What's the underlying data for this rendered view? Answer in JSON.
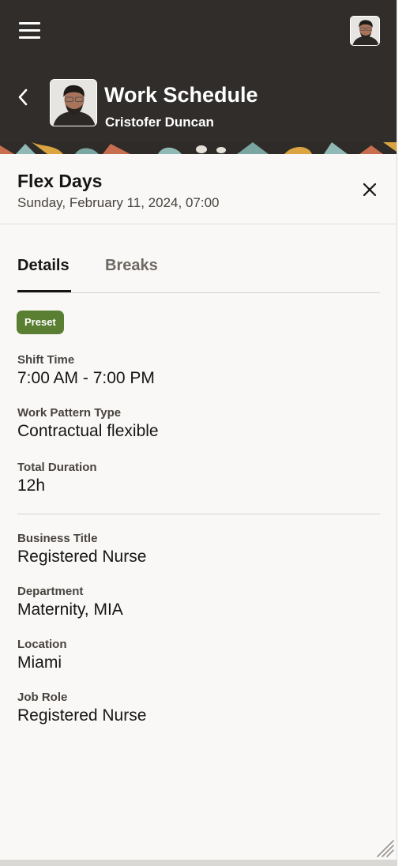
{
  "header": {
    "title": "Work Schedule",
    "subtitle": "Cristofer Duncan",
    "menu_icon": "hamburger-icon",
    "back_icon": "chevron-left-icon",
    "background_color": "#312d2a"
  },
  "drawer": {
    "title": "Flex Days",
    "date": "Sunday, February 11, 2024, 07:00",
    "close_icon": "close-icon"
  },
  "tabs": [
    {
      "label": "Details",
      "selected": true
    },
    {
      "label": "Breaks",
      "selected": false
    }
  ],
  "badge": {
    "label": "Preset",
    "color": "#5a7f32"
  },
  "schedule_fields": [
    {
      "label": "Shift Time",
      "value": "7:00 AM - 7:00 PM"
    },
    {
      "label": "Work Pattern Type",
      "value": "Contractual flexible"
    },
    {
      "label": "Total Duration",
      "value": "12h"
    }
  ],
  "assignment_fields": [
    {
      "label": "Business Title",
      "value": "Registered Nurse"
    },
    {
      "label": "Department",
      "value": "Maternity, MIA"
    },
    {
      "label": "Location",
      "value": "Miami"
    },
    {
      "label": "Job Role",
      "value": "Registered Nurse"
    }
  ]
}
